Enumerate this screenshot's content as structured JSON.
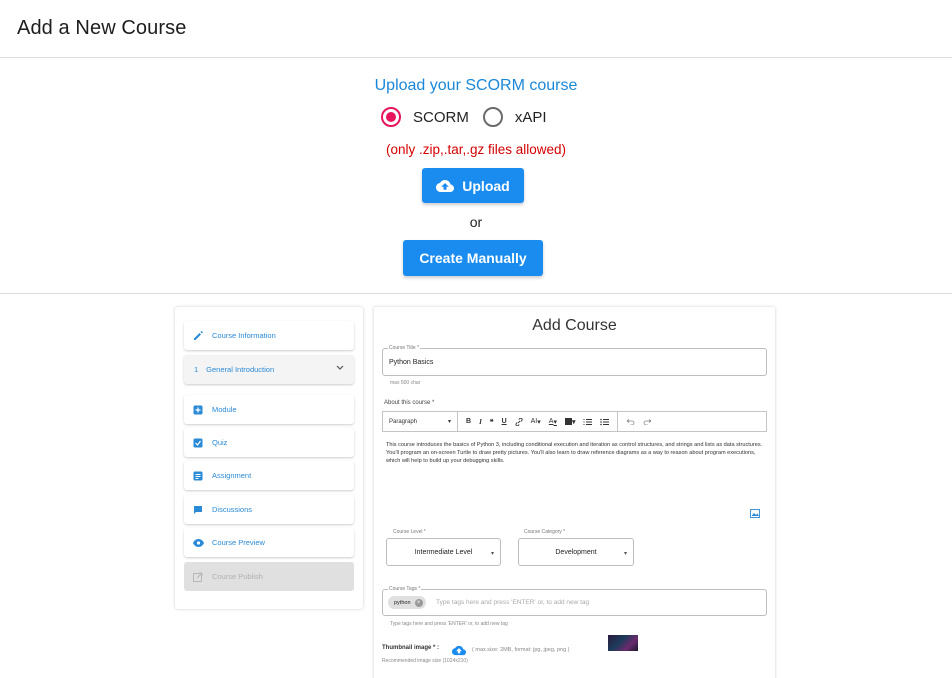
{
  "header": {
    "title": "Add a New Course"
  },
  "upload": {
    "title": "Upload your SCORM course",
    "options": [
      {
        "label": "SCORM",
        "checked": true
      },
      {
        "label": "xAPI",
        "checked": false
      }
    ],
    "allowed_note": "(only .zip,.tar,.gz files allowed)",
    "upload_label": "Upload",
    "or_text": "or",
    "manual_label": "Create Manually"
  },
  "sidebar": {
    "items": [
      {
        "label": "Course Information",
        "icon": "pencil-icon"
      },
      {
        "label": "General Introduction",
        "number": "1",
        "icon": "chevron-down-icon"
      },
      {
        "label": "Module",
        "icon": "module-icon"
      },
      {
        "label": "Quiz",
        "icon": "checkbox-icon"
      },
      {
        "label": "Assignment",
        "icon": "assignment-icon"
      },
      {
        "label": "Discussions",
        "icon": "chat-icon"
      },
      {
        "label": "Course Preview",
        "icon": "eye-icon"
      },
      {
        "label": "Course Publish",
        "icon": "publish-icon",
        "disabled": true
      }
    ]
  },
  "form": {
    "title": "Add Course",
    "course_title_label": "Course Title *",
    "course_title_value": "Python Basics",
    "course_title_hint": "max 500 char",
    "about_label": "About this course *",
    "toolbar": {
      "paragraph": "Paragraph",
      "bold": "B",
      "italic": "I",
      "quote": "❝",
      "underline": "U",
      "font_size": "AI",
      "font_color": "A"
    },
    "about_text": "This course introduces the basics of Python 3, including conditional execution and iteration as control structures, and strings and lists as data structures. You'll program an on-screen Turtle to draw pretty pictures. You'll also learn to draw reference diagrams as a way to reason about program executions, which will help to build up your debugging skills.",
    "level_label": "Course Level *",
    "level_value": "Intermediate Level",
    "category_label": "Course Category *",
    "category_value": "Development",
    "tags_label": "Course Tags *",
    "tag_chip": "python",
    "tags_placeholder": "Type tags here and press 'ENTER' or, to add new tag",
    "tags_hint": "Type tags here and press 'ENTER' or, to add new tag",
    "thumbnail_label": "Thumbnail image * :",
    "thumbnail_info": "( max.size: 2MB, format: jpg, jpeg, png )",
    "thumbnail_hint": "Recommended image size (1024x210)"
  },
  "colors": {
    "accent_blue": "#1a8cf0",
    "radio_pink": "#e8145d",
    "warning_red": "#d40000",
    "link_blue": "#2a8ad6"
  }
}
